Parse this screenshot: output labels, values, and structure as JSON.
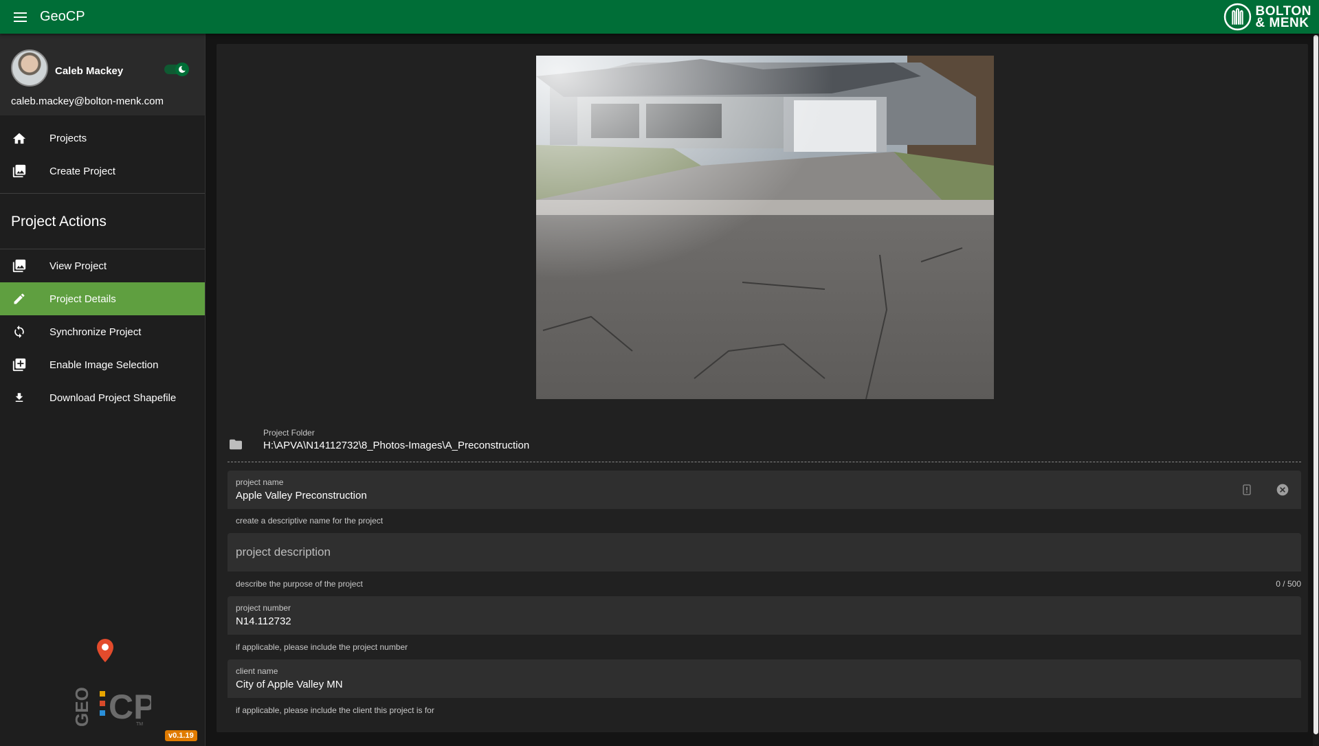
{
  "app": {
    "title": "GeoCP",
    "brand": [
      "BOLTON",
      "& MENK"
    ],
    "version": "v0.1.19"
  },
  "user": {
    "name": "Caleb Mackey",
    "email": "caleb.mackey@bolton-menk.com",
    "dark_mode": true
  },
  "nav": {
    "primary": [
      {
        "label": "Projects",
        "icon": "home-icon"
      },
      {
        "label": "Create Project",
        "icon": "photo-library-icon"
      }
    ],
    "section_title": "Project Actions",
    "actions": [
      {
        "label": "View Project",
        "icon": "photo-library-icon",
        "active": false
      },
      {
        "label": "Project Details",
        "icon": "pencil-icon",
        "active": true
      },
      {
        "label": "Synchronize Project",
        "icon": "sync-icon",
        "active": false
      },
      {
        "label": "Enable Image Selection",
        "icon": "add-box-icon",
        "active": false
      },
      {
        "label": "Download Project Shapefile",
        "icon": "download-icon",
        "active": false
      }
    ]
  },
  "logo": {
    "geo": "GEO",
    "cp": "CP",
    "tm": "TM"
  },
  "folder": {
    "caption": "Project Folder",
    "path": "H:\\APVA\\N14112732\\8_Photos-Images\\A_Preconstruction"
  },
  "form": {
    "name": {
      "label": "project name",
      "value": "Apple Valley Preconstruction",
      "hint": "create a descriptive name for the project"
    },
    "description": {
      "placeholder": "project description",
      "hint": "describe the purpose of the project",
      "counter": "0 / 500"
    },
    "number": {
      "label": "project number",
      "value": "N14.112732",
      "hint": "if applicable, please include the project number"
    },
    "client": {
      "label": "client name",
      "value": "City of Apple Valley MN",
      "hint": "if applicable, please include the client this project is for"
    }
  },
  "colors": {
    "appbar": "#006e37",
    "active_nav": "#5f9f40",
    "version_badge": "#e07b00"
  }
}
